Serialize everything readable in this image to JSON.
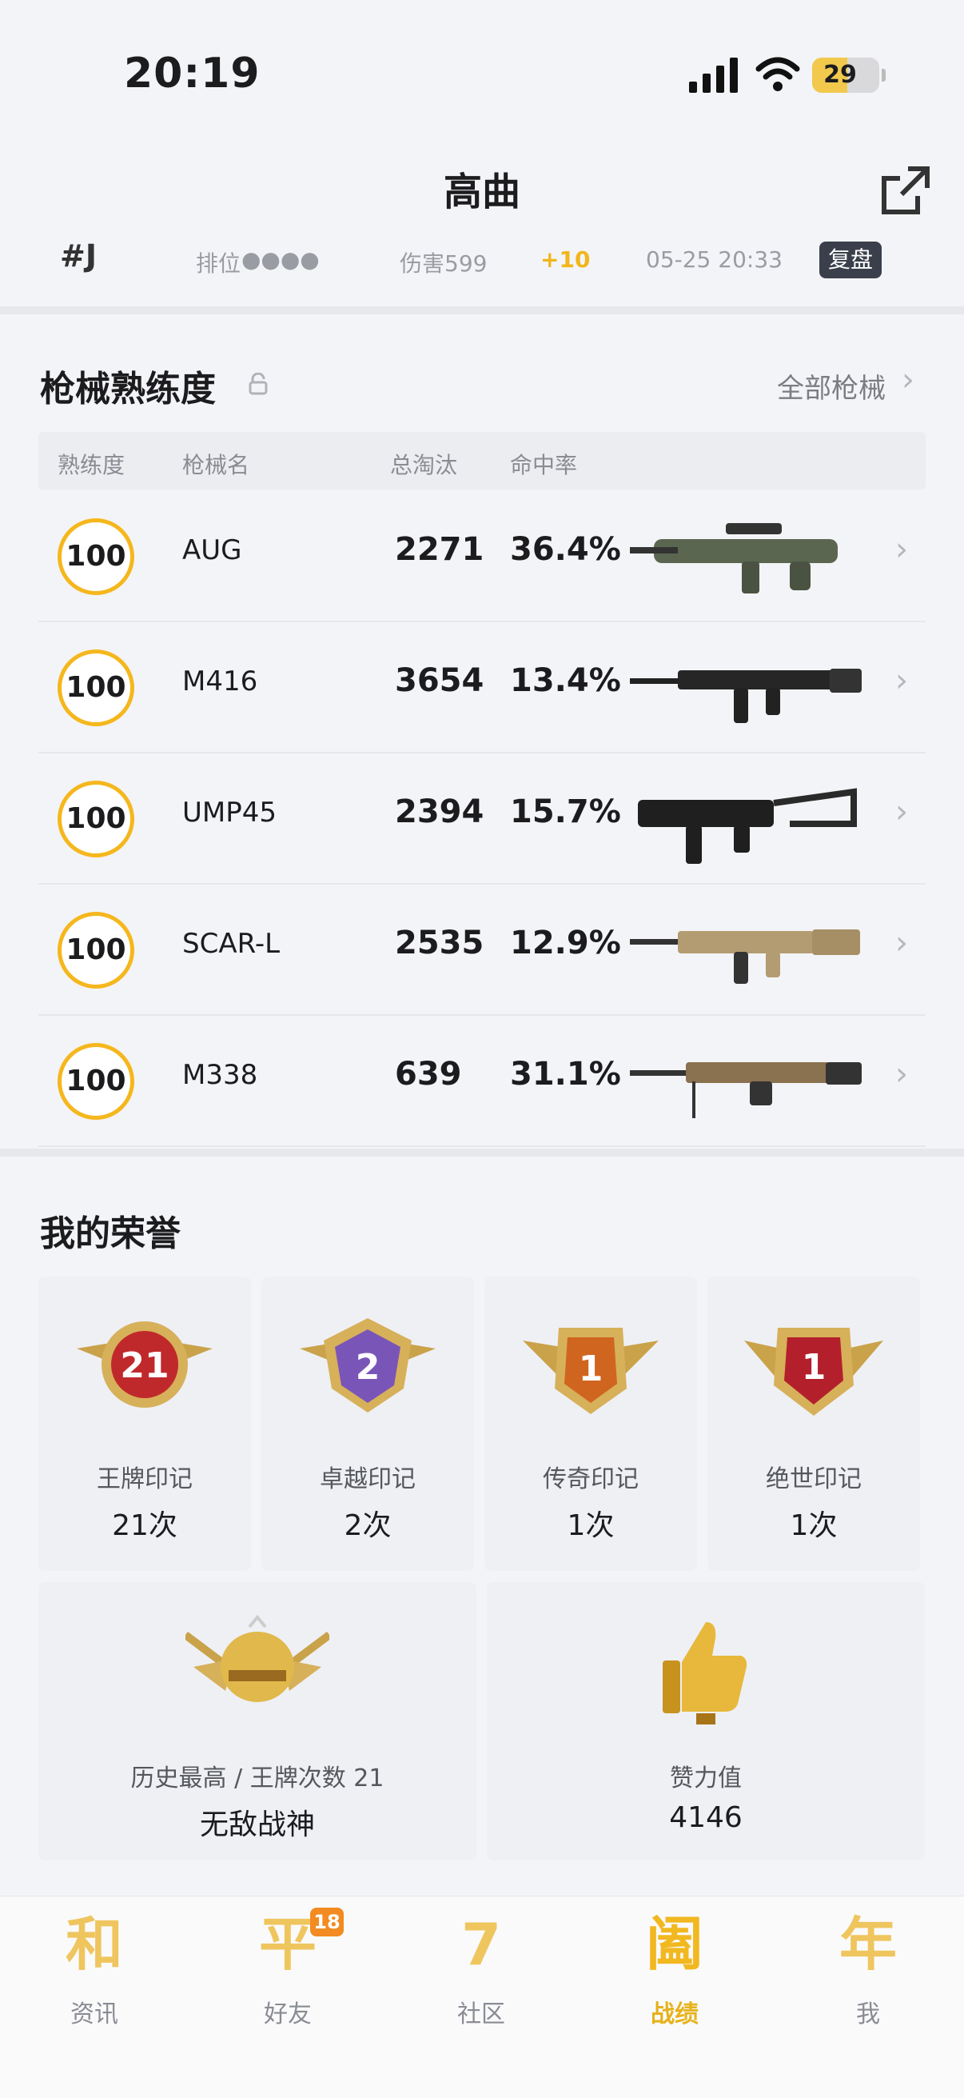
{
  "status": {
    "time": "20:19",
    "battery": "29"
  },
  "header": {
    "title": "高曲"
  },
  "prev_match": {
    "rank": "#J",
    "mode": "排位",
    "damage": "伤害599",
    "delta": "+10",
    "time": "05-25 20:33",
    "replay": "复盘"
  },
  "weapons": {
    "title": "枪械熟练度",
    "all_link": "全部枪械",
    "columns": [
      "熟练度",
      "枪械名",
      "总淘汰",
      "命中率"
    ],
    "rows": [
      {
        "level": "100",
        "name": "AUG",
        "kills": "2271",
        "acc": "36.4%"
      },
      {
        "level": "100",
        "name": "M416",
        "kills": "3654",
        "acc": "13.4%"
      },
      {
        "level": "100",
        "name": "UMP45",
        "kills": "2394",
        "acc": "15.7%"
      },
      {
        "level": "100",
        "name": "SCAR-L",
        "kills": "2535",
        "acc": "12.9%"
      },
      {
        "level": "100",
        "name": "M338",
        "kills": "639",
        "acc": "31.1%"
      }
    ]
  },
  "honors": {
    "title": "我的荣誉",
    "cards": [
      {
        "num": "21",
        "label": "王牌印记",
        "value": "21次",
        "color": "#c0292b"
      },
      {
        "num": "2",
        "label": "卓越印记",
        "value": "2次",
        "color": "#7a55b8"
      },
      {
        "num": "1",
        "label": "传奇印记",
        "value": "1次",
        "color": "#d0651f"
      },
      {
        "num": "1",
        "label": "绝世印记",
        "value": "1次",
        "color": "#b3202c"
      }
    ],
    "wide": [
      {
        "label": "历史最高 / 王牌次数 21",
        "value": "无敌战神"
      },
      {
        "label": "赞力值",
        "value": "4146"
      }
    ]
  },
  "tabs": [
    {
      "glyph": "和",
      "label": "资讯"
    },
    {
      "glyph": "平",
      "label": "好友",
      "badge": "18"
    },
    {
      "glyph": "7",
      "label": "社区"
    },
    {
      "glyph": "阖",
      "label": "战绩"
    },
    {
      "glyph": "年",
      "label": "我"
    }
  ]
}
